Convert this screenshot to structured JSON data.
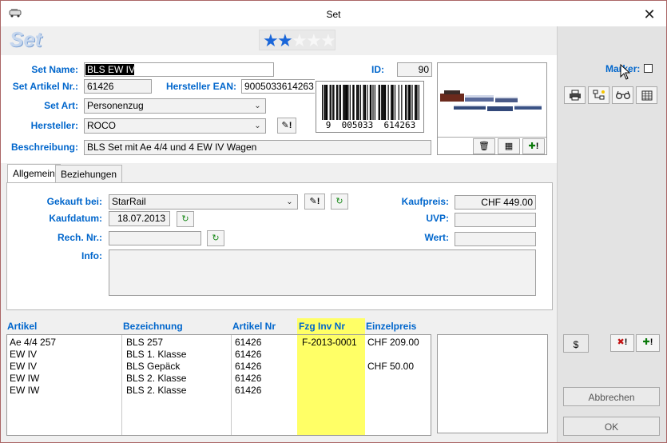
{
  "window": {
    "title": "Set",
    "close_glyph": "✕"
  },
  "header": {
    "title": "Set",
    "rating": {
      "filled": 2,
      "total": 5
    }
  },
  "form": {
    "set_name_label": "Set Name:",
    "set_name_value": "BLS EW IV",
    "id_label": "ID:",
    "id_value": "90",
    "set_artikel_label": "Set Artikel Nr.:",
    "set_artikel_value": "61426",
    "hersteller_ean_label": "Hersteller EAN:",
    "hersteller_ean_value": "9005033614263",
    "set_art_label": "Set Art:",
    "set_art_value": "Personenzug",
    "hersteller_label": "Hersteller:",
    "hersteller_value": "ROCO",
    "beschreibung_label": "Beschreibung:",
    "beschreibung_value": "BLS Set mit Ae 4/4 und 4 EW IV Wagen",
    "barcode_text": "9  005033  614263"
  },
  "tabs": [
    {
      "label": "Allgemein",
      "active": true
    },
    {
      "label": "Beziehungen",
      "active": false
    }
  ],
  "allgemein": {
    "gekauft_bei_label": "Gekauft bei:",
    "gekauft_bei_value": "StarRail",
    "kaufdatum_label": "Kaufdatum:",
    "kaufdatum_value": "18.07.2013",
    "rech_nr_label": "Rech. Nr.:",
    "rech_nr_value": "",
    "info_label": "Info:",
    "kaufpreis_label": "Kaufpreis:",
    "kaufpreis_value": "CHF 449.00",
    "uvp_label": "UVP:",
    "uvp_value": "",
    "wert_label": "Wert:",
    "wert_value": ""
  },
  "table": {
    "headers": [
      "Artikel",
      "Bezeichnung",
      "Artikel Nr",
      "Fzg Inv Nr",
      "Einzelpreis"
    ],
    "rows": [
      [
        "Ae 4/4 257",
        "BLS 257",
        "61426",
        "F-2013-0001",
        "CHF 209.00"
      ],
      [
        "EW IV",
        "BLS 1. Klasse",
        "61426",
        "",
        ""
      ],
      [
        "EW IV",
        "BLS Gepäck",
        "61426",
        "",
        "CHF 50.00"
      ],
      [
        "EW IW",
        "BLS 2. Klasse",
        "61426",
        "",
        ""
      ],
      [
        "EW IW",
        "BLS 2. Klasse",
        "61426",
        "",
        ""
      ]
    ]
  },
  "sidebar": {
    "marker_label": "Marker:",
    "dollar_label": "$",
    "abbrechen_label": "Abbrechen",
    "ok_label": "OK"
  },
  "icons": {
    "print": "printer-icon",
    "tree": "tree-icon",
    "glasses": "glasses-icon",
    "table": "table-icon",
    "edit": "edit-icon",
    "refresh": "refresh-icon",
    "delete": "trash-icon",
    "add": "add-icon",
    "remove": "remove-icon"
  },
  "colors": {
    "label_blue": "#0066cc",
    "highlight_yellow": "#ffff66",
    "star_blue": "#1a66d9"
  }
}
